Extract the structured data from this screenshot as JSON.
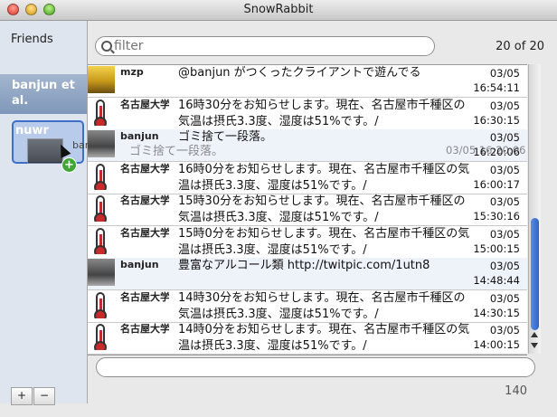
{
  "window": {
    "title": "SnowRabbit"
  },
  "sidebar": {
    "header": "Friends",
    "selected_group": "banjun et al.",
    "drop_target": "nuwr",
    "drag_label": "banjun",
    "add_label": "+",
    "remove_label": "−"
  },
  "search": {
    "placeholder": "filter",
    "count": "20 of 20"
  },
  "timeline": [
    {
      "user": "mzp",
      "avatar": "photo-icon",
      "text": "@banjun がつくったクライアントで遊んでる",
      "date": "03/05",
      "time": "16:54:11"
    },
    {
      "user": "名古屋大学気象お知…",
      "avatar": "thermometer-icon",
      "text": "16時30分をお知らせします。現在、名古屋市千種区の気温は摂氏3.3度、湿度は51%です。/",
      "date": "03/05",
      "time": "16:30:15"
    },
    {
      "user": "banjun",
      "avatar": "photo-icon",
      "text": "ゴミ捨て一段落。",
      "date": "03/05",
      "time": "16:20:06"
    },
    {
      "user": "名古屋大学気象お知…",
      "avatar": "thermometer-icon",
      "text": "16時0分をお知らせします。現在、名古屋市千種区の気温は摂氏3.3度、湿度は51%です。/",
      "date": "03/05",
      "time": "16:00:17"
    },
    {
      "user": "名古屋大学気象お知…",
      "avatar": "thermometer-icon",
      "text": "15時30分をお知らせします。現在、名古屋市千種区の気温は摂氏3.3度、湿度は51%です。/",
      "date": "03/05",
      "time": "15:30:16"
    },
    {
      "user": "名古屋大学気象お知…",
      "avatar": "thermometer-icon",
      "text": "15時0分をお知らせします。現在、名古屋市千種区の気温は摂氏3.3度、湿度は51%です。/",
      "date": "03/05",
      "time": "15:00:15"
    },
    {
      "user": "banjun",
      "avatar": "photo-icon",
      "text": "豊富なアルコール類 http://twitpic.com/1utn8",
      "date": "03/05",
      "time": "14:48:44"
    },
    {
      "user": "名古屋大学気象お知…",
      "avatar": "thermometer-icon",
      "text": "14時30分をお知らせします。現在、名古屋市千種区の気温は摂氏3.3度、湿度は51%です。/",
      "date": "03/05",
      "time": "14:30:15"
    },
    {
      "user": "名古屋大学気象お知…",
      "avatar": "thermometer-icon",
      "text": "14時0分をお知らせします。現在、名古屋市千種区の気温は摂氏3.3度、湿度は51%です。/",
      "date": "03/05",
      "time": "14:00:15"
    }
  ],
  "drag_ghost": {
    "text": "ゴミ捨て一段落。",
    "date": "03/05",
    "time": "16:20:06"
  },
  "compose": {
    "value": "",
    "remaining": "140"
  }
}
